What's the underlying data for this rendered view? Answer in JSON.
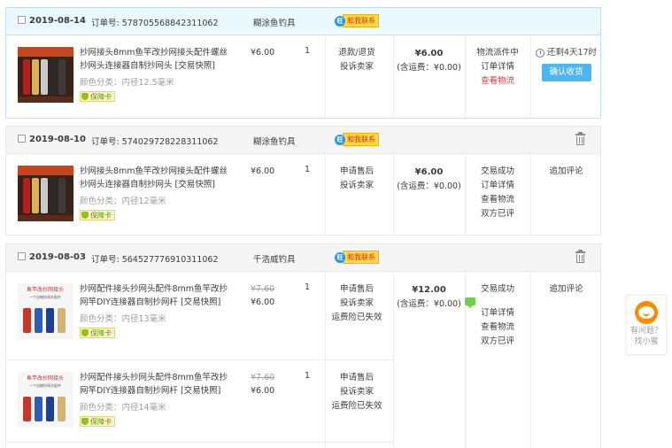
{
  "orders": [
    {
      "date": "2019-08-14",
      "order_no": "订单号: 578705568842311062",
      "shop": "糊涂鱼钓具",
      "contact": "和我联系",
      "items": [
        {
          "name": "抄网接头8mm鱼竿改抄网接头配件螺丝抄网头连接器自制抄网头 [交易快照]",
          "sku": "颜色分类：内径12.5毫米",
          "badge": "保障卡",
          "old_price": "",
          "price": "¥6.00",
          "qty": "1",
          "services": [
            "退款/退货",
            "投诉卖家"
          ]
        }
      ],
      "total": "¥6.00",
      "shipping": "(含运费：¥0.00)",
      "status": [
        "物流派件中",
        "订单详情"
      ],
      "status_highlight": "查看物流",
      "timer": "还剩4天17时",
      "confirm": "确认收货"
    },
    {
      "date": "2019-08-10",
      "order_no": "订单号: 574029728228311062",
      "shop": "糊涂鱼钓具",
      "contact": "和我联系",
      "items": [
        {
          "name": "抄网接头8mm鱼竿改抄网接头配件螺丝抄网头连接器自制抄网头 [交易快照]",
          "sku": "颜色分类：内径12毫米",
          "badge": "保障卡",
          "old_price": "",
          "price": "¥6.00",
          "qty": "1",
          "services": [
            "申请售后",
            "投诉卖家"
          ]
        }
      ],
      "total": "¥6.00",
      "shipping": "(含运费：¥0.00)",
      "status": [
        "交易成功",
        "订单详情",
        "查看物流",
        "双方已评"
      ],
      "op": "追加评论"
    },
    {
      "date": "2019-08-03",
      "order_no": "订单号: 564527776910311062",
      "shop": "千浩威钓具",
      "contact": "和我联系",
      "items": [
        {
          "name": "抄网配件接头抄网头配件8mm鱼竿改抄网竿DIY连接器自制抄网杆 [交易快照]",
          "sku": "颜色分类：内径13毫米",
          "badge": "保障卡",
          "old_price": "¥7.60",
          "price": "¥6.00",
          "qty": "1",
          "services": [
            "申请售后",
            "投诉卖家",
            "运费险已失效"
          ]
        },
        {
          "name": "抄网配件接头抄网头配件8mm鱼竿改抄网竿DIY连接器自制抄网杆 [交易快照]",
          "sku": "颜色分类：内径14毫米",
          "badge": "保障卡",
          "old_price": "¥7.60",
          "price": "¥6.00",
          "qty": "1",
          "services": [
            "申请售后",
            "投诉卖家",
            "运费险已失效"
          ]
        }
      ],
      "total": "¥12.00",
      "shipping": "(含运费：¥0.00)",
      "status_top": "交易成功",
      "status": [
        "订单详情",
        "查看物流",
        "双方已评"
      ],
      "op": "追加评论"
    }
  ],
  "helper": {
    "line1": "有问题？",
    "line2": "找小蜜"
  },
  "thumb_text": {
    "banner": "鱼竿改抄网接头",
    "sub": "一个自制抄网头配件"
  }
}
